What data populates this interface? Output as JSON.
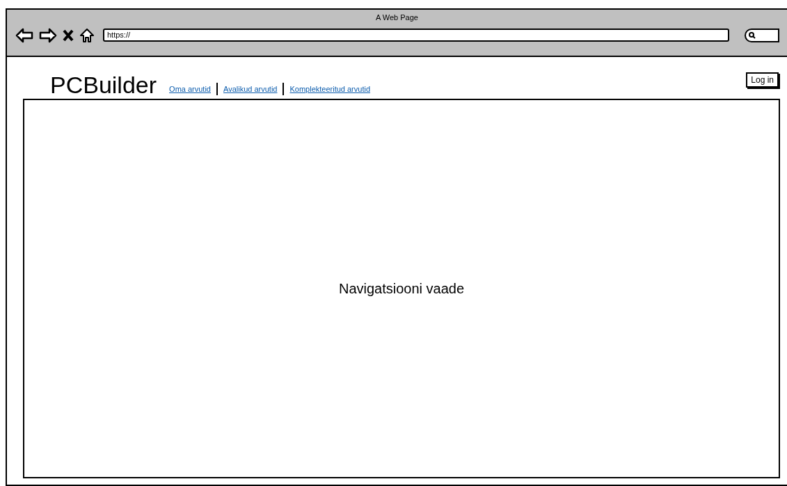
{
  "window": {
    "title": "A Web Page",
    "address": "https://"
  },
  "header": {
    "logo": "PCBuilder",
    "nav": [
      "Oma arvutid",
      "Avalikud arvutid",
      "Komplekteeritud arvutid"
    ],
    "login": "Log in"
  },
  "main": {
    "text": "Navigatsiooni vaade"
  }
}
